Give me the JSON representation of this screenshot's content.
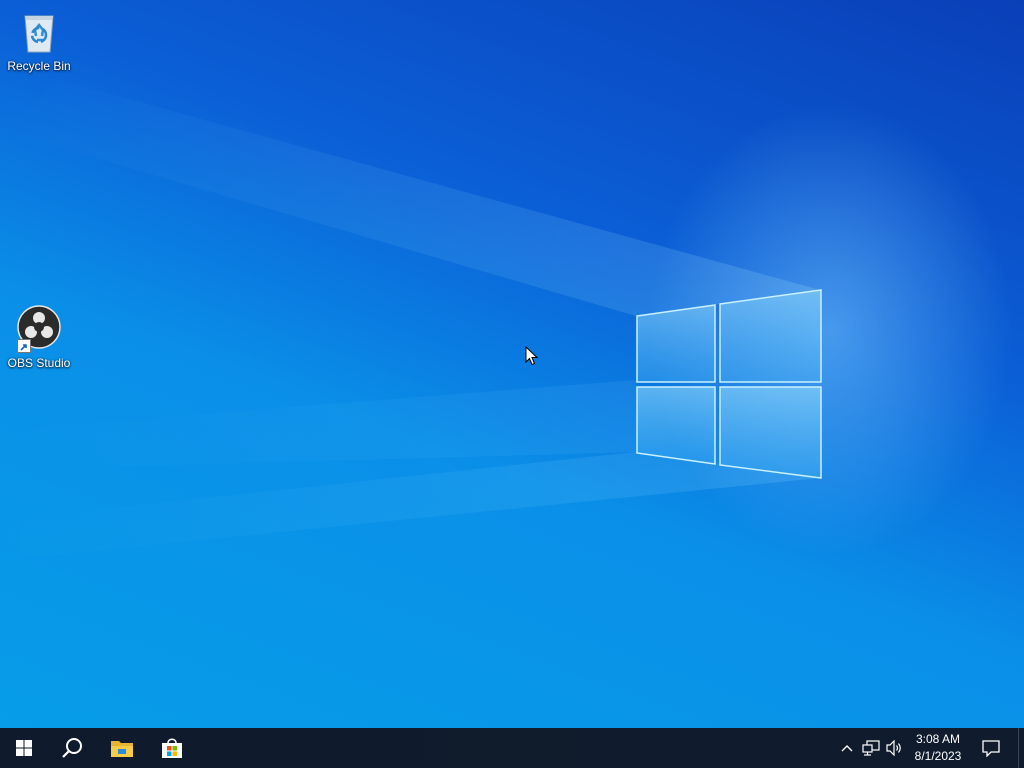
{
  "desktop": {
    "icons": [
      {
        "label": "Recycle Bin",
        "icon": "recycle-bin-icon"
      },
      {
        "label": "OBS Studio",
        "icon": "obs-studio-icon"
      }
    ]
  },
  "taskbar": {
    "start": {
      "icon": "windows-logo-icon"
    },
    "search": {
      "icon": "search-icon"
    },
    "pinned": [
      {
        "name": "File Explorer",
        "icon": "file-explorer-icon"
      },
      {
        "name": "Microsoft Store",
        "icon": "microsoft-store-icon"
      }
    ],
    "tray": {
      "show_hidden_icon": "chevron-up-icon",
      "network_icon": "network-icon",
      "volume_icon": "volume-icon",
      "notifications_icon": "notification-icon"
    },
    "clock": {
      "time": "3:08 AM",
      "date": "8/1/2023"
    }
  },
  "colors": {
    "taskbar": "#0f1b2c",
    "wallpaper_dark": "#0a3fb8",
    "wallpaper_light": "#079de8"
  }
}
